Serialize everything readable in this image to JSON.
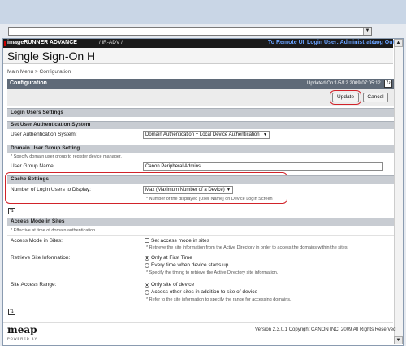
{
  "app": {
    "brand": "imageRUNNER ADVANCE",
    "sub_brand": "/ iR-ADV /",
    "to_remote_ui": "To Remote UI",
    "login_user": "Login User: Administrator",
    "log_out": "Log Out",
    "page_title": "Single Sign-On H",
    "breadcrumb": "Main Menu > Configuration"
  },
  "config": {
    "header": "Configuration",
    "updated": "Updated On:1/5/12  2009  07:05:12",
    "update_btn": "Update",
    "cancel_btn": "Cancel"
  },
  "sections": {
    "login_users": "Login Users Settings",
    "set_auth": "Set User Authentication System",
    "auth_label": "User Authentication System:",
    "auth_value": "Domain Authentication + Local Device Authentication",
    "domain_group": "Domain User Group Setting",
    "domain_note": "* Specify domain user group to register device manager.",
    "group_label": "User Group Name:",
    "group_value": "Canon Peripheral Admins",
    "cache": "Cache Settings",
    "num_label": "Number of Login Users to Display:",
    "num_value": "Max (Maximum Number of a Device)",
    "num_note": "* Number of the displayed [User Name] on Device Login Screen",
    "access_mode": "Access Mode in Sites",
    "access_note": "* Effective at time of domain authentication",
    "access_label": "Access Mode in Sites:",
    "access_check": "Set access mode in sites",
    "access_desc": "* Retrieve the site information from the Active Directory in order to access the domains within the sites.",
    "retrieve_label": "Retrieve Site Information:",
    "retrieve_opt1": "Only at First Time",
    "retrieve_opt2": "Every time when device starts up",
    "retrieve_note": "* Specify the timing to retrieve the Active Directory site information.",
    "range_label": "Site Access Range:",
    "range_opt1": "Only site of device",
    "range_opt2": "Access other sites in addition to site of device",
    "range_note": "* Refer to the site information to specify the range for accessing domains."
  },
  "footer": {
    "logo": "meap",
    "logo_sub": "POWERED BY",
    "copyright": "Version 2.3.0.1 Copyright CANON INC. 2009 All Rights Reserved"
  },
  "colors": {
    "highlight": "#d1232a",
    "link": "#6aa3ff",
    "section_bg": "#c8ccd2",
    "config_bar": "#5f6a78"
  }
}
